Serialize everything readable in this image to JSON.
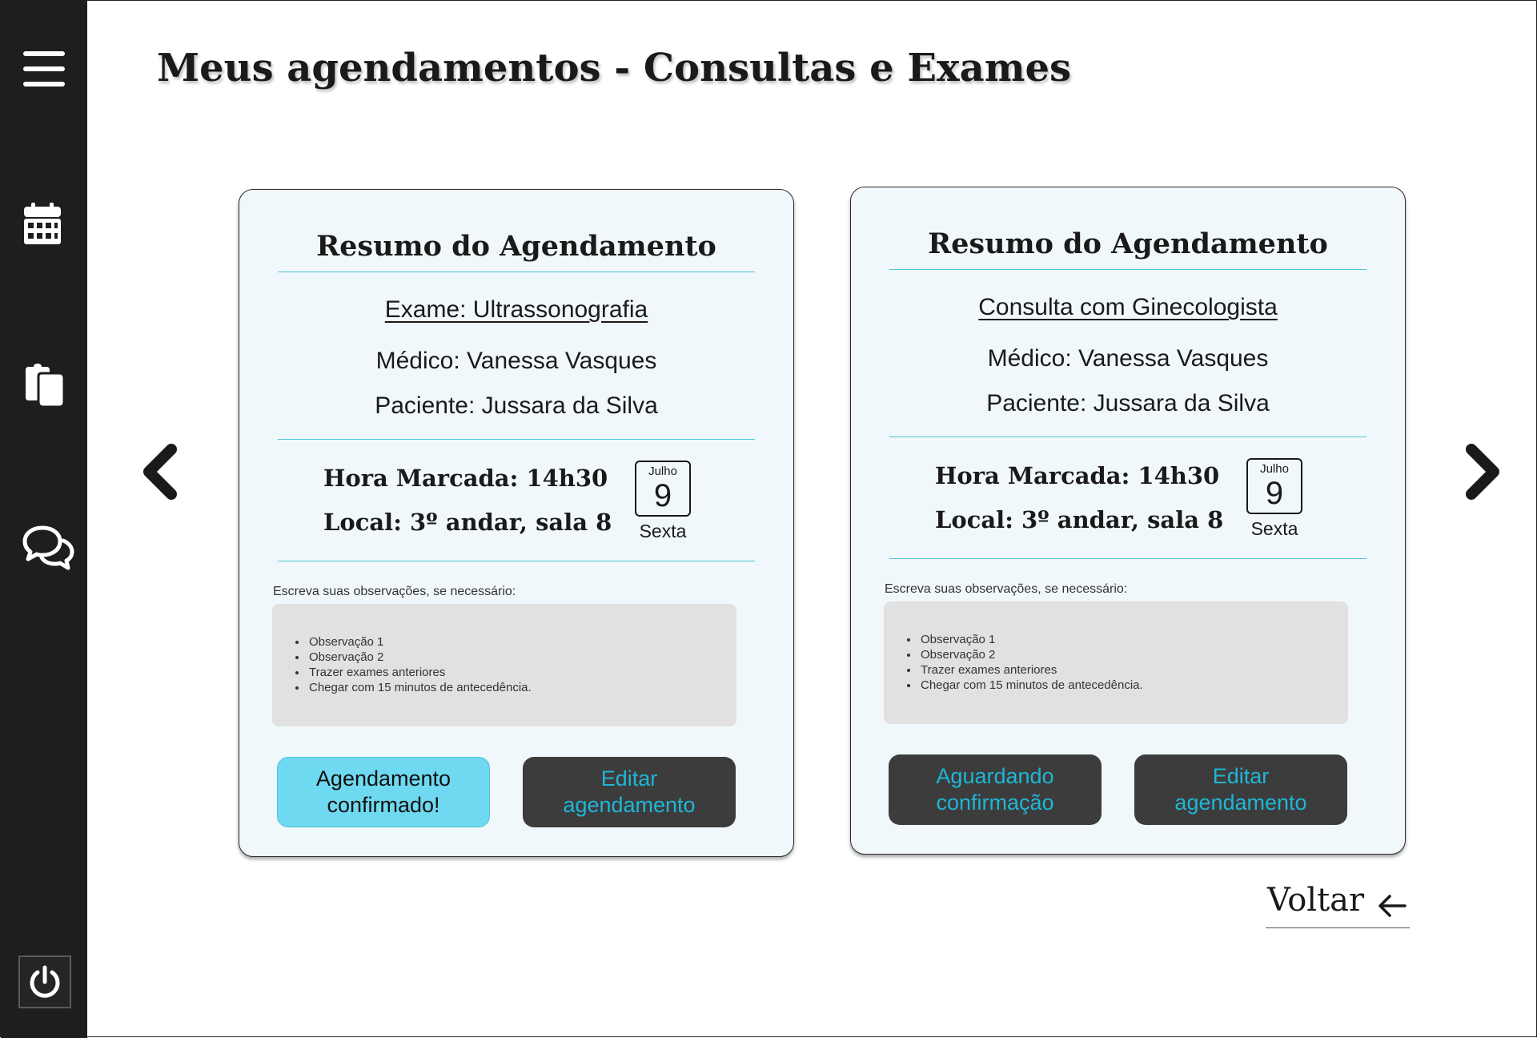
{
  "page": {
    "title": "Meus agendamentos - Consultas e Exames"
  },
  "sidebar": {
    "icons": [
      "menu-icon",
      "calendar-icon",
      "clipboard-icon",
      "chat-icon"
    ],
    "power_icon": "power-icon"
  },
  "colors": {
    "sidebar_bg": "#1e1e1e",
    "accent_cyan": "#4cc3d9",
    "confirmed_button": "#6ed9f0",
    "dark_button": "#3c3c3c",
    "dark_button_text": "#1fb6d6",
    "card_bg": "#f1f8fb",
    "obs_bg": "#e1e1e1"
  },
  "cards": [
    {
      "title": "Resumo do Agendamento",
      "subject": "Exame: Ultrassonografia",
      "doctor": "Médico: Vanessa Vasques",
      "patient": "Paciente: Jussara da Silva",
      "time": "Hora Marcada: 14h30",
      "place": "Local: 3º andar, sala 8",
      "calendar": {
        "month": "Julho",
        "day": "9",
        "weekday": "Sexta"
      },
      "obs_label": "Escreva suas observações, se necessário:",
      "observations": [
        "Observação 1",
        "Observação 2",
        "Trazer exames anteriores",
        "Chegar com 15 minutos de antecedência."
      ],
      "status_button": "Agendamento\nconfirmado!",
      "edit_button": "Editar\nagendamento"
    },
    {
      "title": "Resumo do Agendamento",
      "subject": "Consulta com Ginecologista",
      "doctor": "Médico: Vanessa Vasques",
      "patient": "Paciente: Jussara da Silva",
      "time": "Hora Marcada: 14h30",
      "place": "Local: 3º andar, sala 8",
      "calendar": {
        "month": "Julho",
        "day": "9",
        "weekday": "Sexta"
      },
      "obs_label": "Escreva suas observações, se necessário:",
      "observations": [
        "Observação 1",
        "Observação 2",
        "Trazer exames anteriores",
        "Chegar com 15 minutos de antecedência."
      ],
      "status_button": "Aguardando\nconfirmação",
      "edit_button": "Editar\nagendamento"
    }
  ],
  "navigation": {
    "prev_icon": "chevron-left-icon",
    "next_icon": "chevron-right-icon",
    "back_label": "Voltar",
    "back_icon": "arrow-left-icon"
  }
}
